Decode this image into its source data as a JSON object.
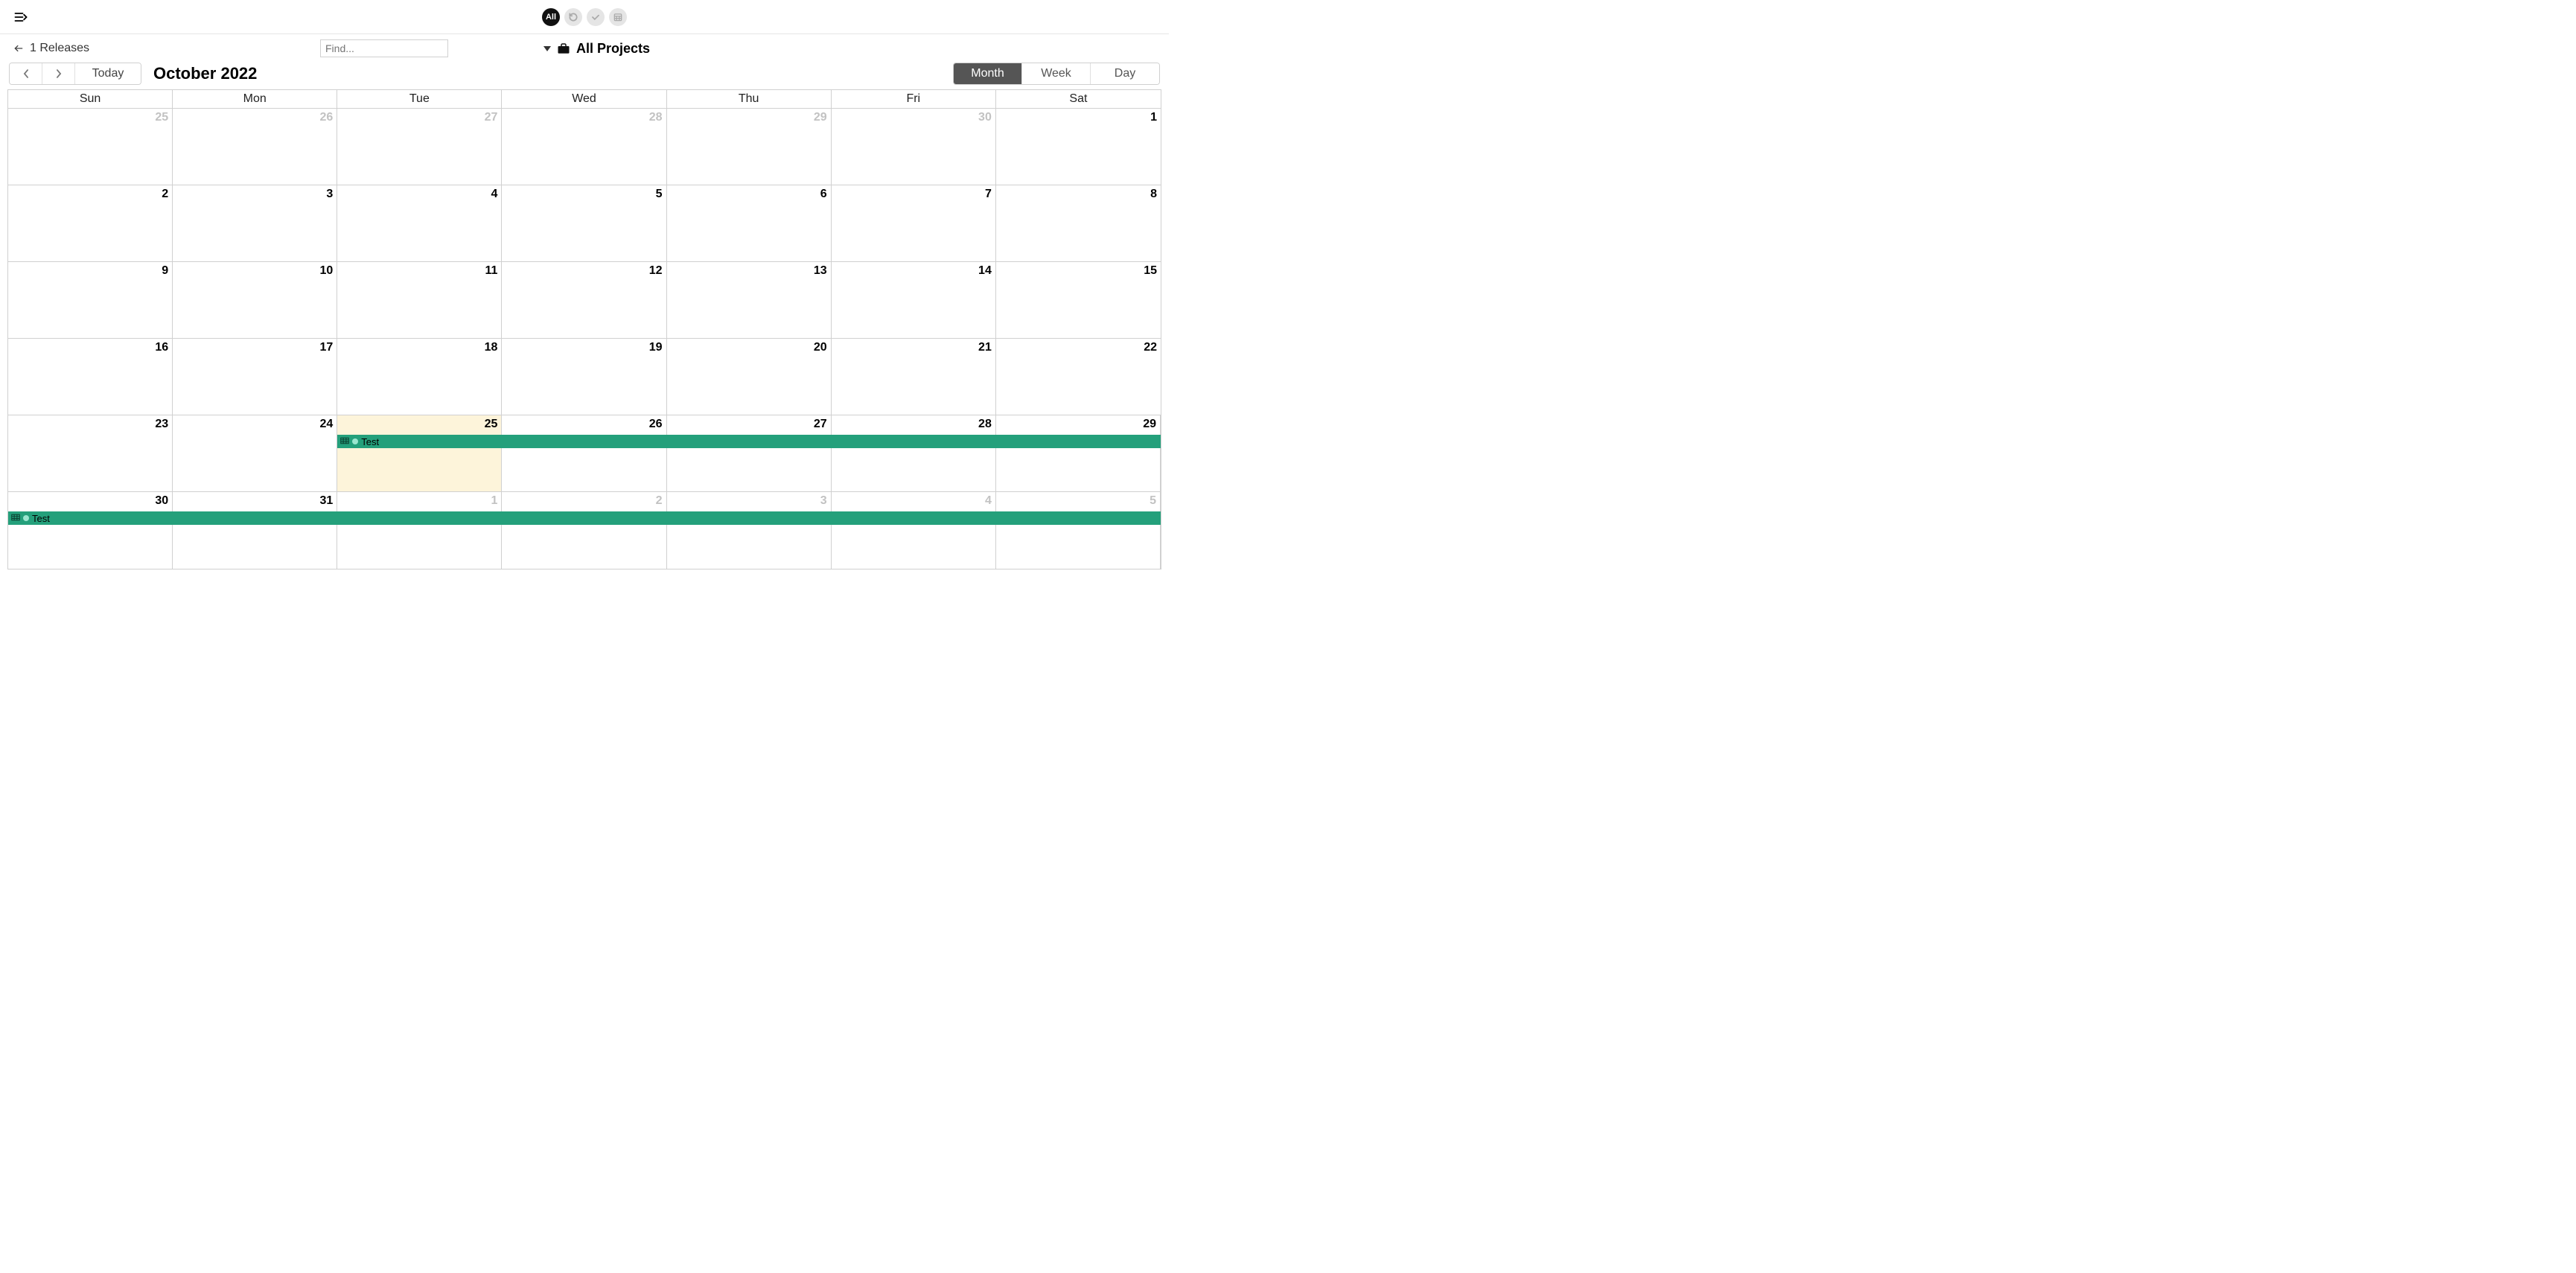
{
  "topbar": {
    "all_label": "All"
  },
  "subbar": {
    "releases_count": "1 Releases",
    "find_placeholder": "Find...",
    "projects_label": "All Projects"
  },
  "controls": {
    "today_label": "Today",
    "title": "October 2022",
    "views": {
      "month": "Month",
      "week": "Week",
      "day": "Day"
    }
  },
  "calendar": {
    "dow": [
      "Sun",
      "Mon",
      "Tue",
      "Wed",
      "Thu",
      "Fri",
      "Sat"
    ],
    "weeks": [
      [
        {
          "n": "25",
          "out": true
        },
        {
          "n": "26",
          "out": true
        },
        {
          "n": "27",
          "out": true
        },
        {
          "n": "28",
          "out": true
        },
        {
          "n": "29",
          "out": true
        },
        {
          "n": "30",
          "out": true
        },
        {
          "n": "1",
          "out": false
        }
      ],
      [
        {
          "n": "2"
        },
        {
          "n": "3"
        },
        {
          "n": "4"
        },
        {
          "n": "5"
        },
        {
          "n": "6"
        },
        {
          "n": "7"
        },
        {
          "n": "8"
        }
      ],
      [
        {
          "n": "9"
        },
        {
          "n": "10"
        },
        {
          "n": "11"
        },
        {
          "n": "12"
        },
        {
          "n": "13"
        },
        {
          "n": "14"
        },
        {
          "n": "15"
        }
      ],
      [
        {
          "n": "16"
        },
        {
          "n": "17"
        },
        {
          "n": "18"
        },
        {
          "n": "19"
        },
        {
          "n": "20"
        },
        {
          "n": "21"
        },
        {
          "n": "22"
        }
      ],
      [
        {
          "n": "23"
        },
        {
          "n": "24"
        },
        {
          "n": "25",
          "today": true
        },
        {
          "n": "26"
        },
        {
          "n": "27"
        },
        {
          "n": "28"
        },
        {
          "n": "29"
        }
      ],
      [
        {
          "n": "30"
        },
        {
          "n": "31"
        },
        {
          "n": "1",
          "out": true
        },
        {
          "n": "2",
          "out": true
        },
        {
          "n": "3",
          "out": true
        },
        {
          "n": "4",
          "out": true
        },
        {
          "n": "5",
          "out": true
        }
      ]
    ],
    "events": [
      {
        "label": "Test",
        "week": 4,
        "startCol": 2,
        "endCol": 7
      },
      {
        "label": "Test",
        "week": 5,
        "startCol": 0,
        "endCol": 7
      }
    ]
  }
}
